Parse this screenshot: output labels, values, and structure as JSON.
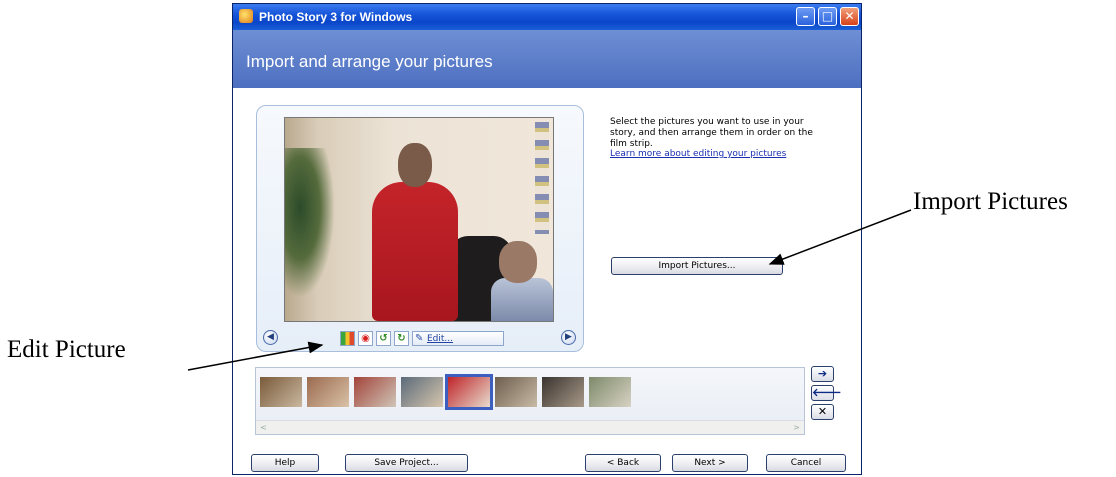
{
  "window": {
    "title": "Photo Story 3 for Windows",
    "controls": {
      "minimize": "–",
      "maximize": "□",
      "close": "✕"
    }
  },
  "header": {
    "title": "Import and arrange your pictures"
  },
  "preview": {
    "prev_glyph": "◀",
    "next_glyph": "▶",
    "toolbar": {
      "edit_label": "Edit...",
      "icons": [
        "auto-levels-icon",
        "red-eye-icon",
        "rotate-left-icon",
        "rotate-right-icon",
        "edit-pencil-icon"
      ]
    }
  },
  "instructions": {
    "text": "Select the pictures you want to use in your story, and then arrange them in order on the film strip.",
    "link": "Learn more about editing your pictures"
  },
  "import_button": {
    "label": "Import Pictures..."
  },
  "filmstrip": {
    "selected_index": 4,
    "thumbnails": [
      {
        "colors": [
          "#7a5a3a",
          "#c9b8a0"
        ]
      },
      {
        "colors": [
          "#9b6a4e",
          "#d9c2a8"
        ]
      },
      {
        "colors": [
          "#a3443a",
          "#cfc5b8"
        ]
      },
      {
        "colors": [
          "#5b6a7a",
          "#d6c6ad"
        ]
      },
      {
        "colors": [
          "#c0242a",
          "#e7dccd"
        ]
      },
      {
        "colors": [
          "#6e5e4e",
          "#c8bba6"
        ]
      },
      {
        "colors": [
          "#3a3330",
          "#a89a88"
        ]
      },
      {
        "colors": [
          "#7d8a6a",
          "#d8d2c4"
        ]
      }
    ]
  },
  "side_buttons": {
    "move_right": "➔",
    "move_left": "🡐",
    "remove": "✕"
  },
  "footer": {
    "help": "Help",
    "save": "Save Project...",
    "back": "< Back",
    "next": "Next >",
    "cancel": "Cancel"
  },
  "annotations": {
    "import": "Import Pictures",
    "edit": "Edit Picture"
  }
}
